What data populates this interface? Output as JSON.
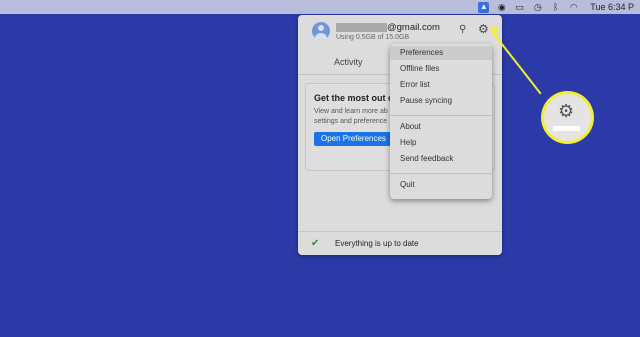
{
  "menubar": {
    "icons": [
      "google-drive-icon",
      "creative-cloud-icon",
      "window-icon",
      "time-machine-icon",
      "bluetooth-icon",
      "wifi-icon"
    ],
    "clock": "Tue 6:34 P"
  },
  "account": {
    "email_suffix": "@gmail.com",
    "usage": "Using 0.5GB of 15.0GB"
  },
  "tabs": {
    "activity": "Activity"
  },
  "card": {
    "title": "Get the most out of",
    "text": "View and learn more ab settings and preference",
    "button": "Open Preferences"
  },
  "menu": {
    "items": [
      "Preferences",
      "Offline files",
      "Error list",
      "Pause syncing",
      "About",
      "Help",
      "Send feedback",
      "Quit"
    ],
    "highlighted": "Preferences"
  },
  "footer": {
    "status": "Everything is up to date"
  },
  "colors": {
    "desktop": "#2c3aa7",
    "highlight": "#f2ef2f",
    "button": "#1a73e8",
    "check": "#1e8e3e"
  }
}
